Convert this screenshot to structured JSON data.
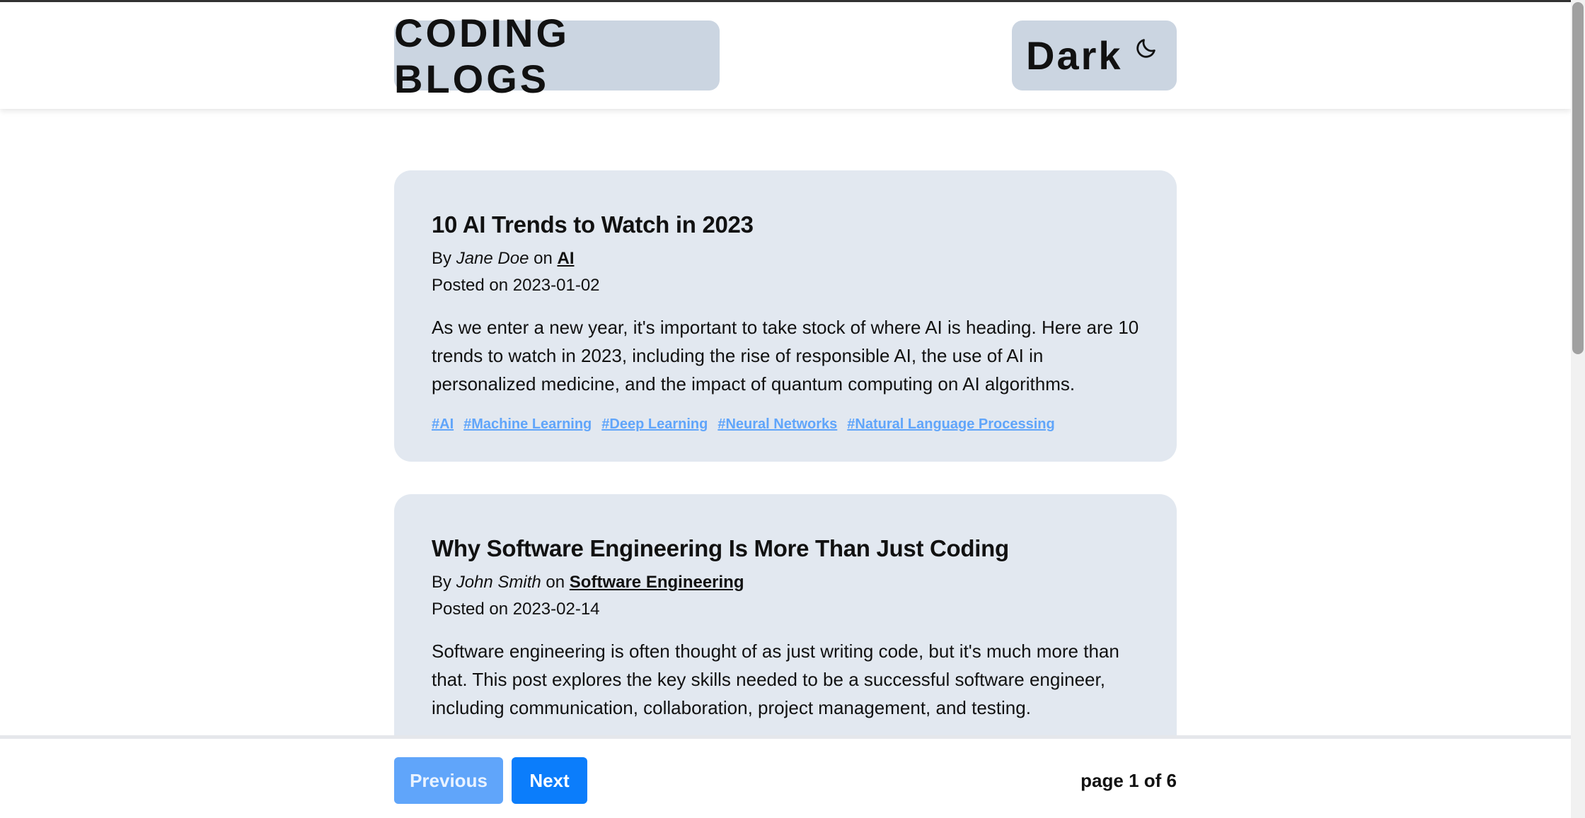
{
  "header": {
    "brand": "CODING BLOGS",
    "theme_toggle_label": "Dark",
    "theme_icon": "moon-icon"
  },
  "posts": [
    {
      "title": "10 AI Trends to Watch in 2023",
      "by_prefix": "By",
      "author": "Jane Doe",
      "on_text": "on",
      "category": "AI",
      "date_prefix": "Posted on",
      "date": "2023-01-02",
      "excerpt": "As we enter a new year, it's important to take stock of where AI is heading. Here are 10 trends to watch in 2023, including the rise of responsible AI, the use of AI in personalized medicine, and the impact of quantum computing on AI algorithms.",
      "tags": [
        "#AI",
        "#Machine Learning",
        "#Deep Learning",
        "#Neural Networks",
        "#Natural Language Processing"
      ]
    },
    {
      "title": "Why Software Engineering Is More Than Just Coding",
      "by_prefix": "By",
      "author": "John Smith",
      "on_text": "on",
      "category": "Software Engineering",
      "date_prefix": "Posted on",
      "date": "2023-02-14",
      "excerpt": "Software engineering is often thought of as just writing code, but it's much more than that. This post explores the key skills needed to be a successful software engineer, including communication, collaboration, project management, and testing."
    }
  ],
  "pagination": {
    "previous_label": "Previous",
    "next_label": "Next",
    "page_info": "page 1 of 6"
  },
  "colors": {
    "header_pill": "#cbd5e1",
    "card_background": "#e2e8f0",
    "tag_link": "#60a5fa",
    "next_button": "#0b7dfb",
    "previous_button": "#60a5fa"
  }
}
